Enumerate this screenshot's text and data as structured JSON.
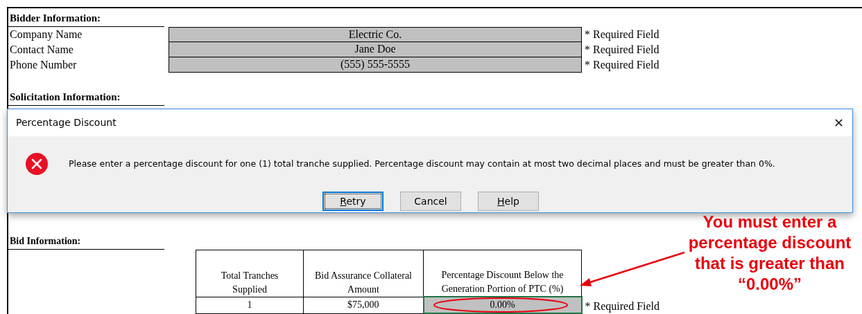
{
  "bidder_section": {
    "heading": "Bidder Information:",
    "rows": [
      {
        "label": "Company Name",
        "value": "Electric Co.",
        "note": "* Required Field"
      },
      {
        "label": "Contact Name",
        "value": "Jane Doe",
        "note": "* Required Field"
      },
      {
        "label": "Phone Number",
        "value": "(555) 555-5555",
        "note": "* Required Field"
      }
    ]
  },
  "solicitation_section": {
    "heading": "Solicitation Information:"
  },
  "dialog": {
    "title": "Percentage Discount",
    "close": "✕",
    "message": "Please enter a percentage discount for one (1) total tranche supplied. Percentage discount may contain at most two decimal places and must be greater than 0%.",
    "buttons": [
      {
        "label": "Retry",
        "mnemonic": true,
        "selected": true
      },
      {
        "label": "Cancel",
        "mnemonic": false,
        "selected": false
      },
      {
        "label": "Help",
        "mnemonic": true,
        "selected": false
      }
    ]
  },
  "bid_section": {
    "heading": "Bid Information:",
    "table": {
      "columns": [
        "Total Tranches Supplied",
        "Bid Assurance Collateral Amount",
        "Percentage Discount Below the Generation Portion of PTC (%)"
      ],
      "rows": [
        [
          "1",
          "$75,000",
          "0.00%"
        ]
      ]
    },
    "note": "* Required Field"
  },
  "callout": {
    "text": "You must enter a percentage discount that is greater than “0.00%”"
  }
}
